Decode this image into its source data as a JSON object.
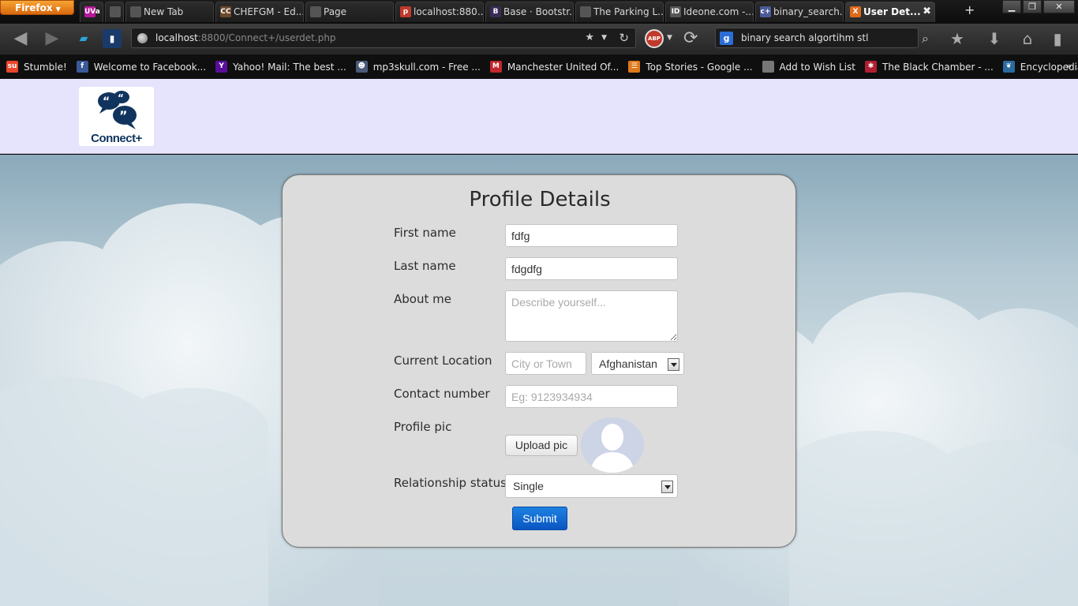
{
  "browser": {
    "menu_label": "Firefox",
    "tabs": [
      {
        "label": "",
        "icon": "uva-icon",
        "color": "#b5189a",
        "glyph": "UVa"
      },
      {
        "label": "",
        "icon": "page-icon",
        "color": "#555555",
        "glyph": ""
      },
      {
        "label": "New Tab",
        "icon": "page-icon",
        "color": "#555555",
        "glyph": ""
      },
      {
        "label": "CHEFGM - Ed...",
        "icon": "codechef-icon",
        "color": "#6b4a2a",
        "glyph": "CC"
      },
      {
        "label": "Page",
        "icon": "page-icon",
        "color": "#555555",
        "glyph": ""
      },
      {
        "label": "localhost:880...",
        "icon": "phpmyadmin-icon",
        "color": "#c0392b",
        "glyph": "p"
      },
      {
        "label": "Base · Bootstr...",
        "icon": "bootstrap-icon",
        "color": "#3b2a56",
        "glyph": "B"
      },
      {
        "label": "The Parking L...",
        "icon": "page-icon",
        "color": "#555555",
        "glyph": ""
      },
      {
        "label": "Ideone.com -...",
        "icon": "ideone-icon",
        "color": "#555555",
        "glyph": "ID"
      },
      {
        "label": "binary_search...",
        "icon": "cplusplus-icon",
        "color": "#4a5a9a",
        "glyph": "c+"
      },
      {
        "label": "User Det...",
        "icon": "xampp-icon",
        "color": "#e06a1a",
        "glyph": "X",
        "active": true
      }
    ],
    "url_host": "localhost",
    "url_rest": ":8800/Connect+/userdet.php",
    "search_query": "binary search algortihm stl",
    "bookmarks": [
      {
        "label": "Stumble!",
        "icon": "stumbleupon-icon",
        "color": "#e8472b",
        "glyph": "su"
      },
      {
        "label": "Welcome to Facebook...",
        "icon": "facebook-icon",
        "color": "#3b5998",
        "glyph": "f"
      },
      {
        "label": "Yahoo! Mail: The best ...",
        "icon": "yahoo-icon",
        "color": "#5a0f9a",
        "glyph": "Y"
      },
      {
        "label": "mp3skull.com - Free ...",
        "icon": "alien-icon",
        "color": "#4a5a7a",
        "glyph": "☻"
      },
      {
        "label": "Manchester United Of...",
        "icon": "manutd-icon",
        "color": "#c0282d",
        "glyph": "M"
      },
      {
        "label": "Top Stories - Google ...",
        "icon": "rss-icon",
        "color": "#e07a1a",
        "glyph": "☰"
      },
      {
        "label": "Add to Wish List",
        "icon": "page-icon",
        "color": "#777777",
        "glyph": ""
      },
      {
        "label": "The Black Chamber - ...",
        "icon": "flag-icon",
        "color": "#b02030",
        "glyph": "✱"
      },
      {
        "label": "Encyclopedia - Britan...",
        "icon": "britannica-icon",
        "color": "#2a6aa0",
        "glyph": "❦"
      }
    ]
  },
  "site": {
    "logo_text": "Connect+"
  },
  "form": {
    "title": "Profile Details",
    "first_name_label": "First name",
    "first_name_value": "fdfg",
    "last_name_label": "Last name",
    "last_name_value": "fdgdfg",
    "about_label": "About me",
    "about_placeholder": "Describe yourself...",
    "location_label": "Current Location",
    "city_placeholder": "City or Town",
    "country_value": "Afghanistan",
    "contact_label": "Contact number",
    "contact_placeholder": "Eg: 9123934934",
    "pic_label": "Profile pic",
    "upload_label": "Upload pic",
    "relationship_label": "Relationship status",
    "relationship_value": "Single",
    "submit_label": "Submit"
  },
  "colors": {
    "header_bg": "#e6e4fc",
    "card_bg": "#dcdcdc",
    "submit_bg": "#1466d6",
    "logo_blue": "#10345e"
  }
}
